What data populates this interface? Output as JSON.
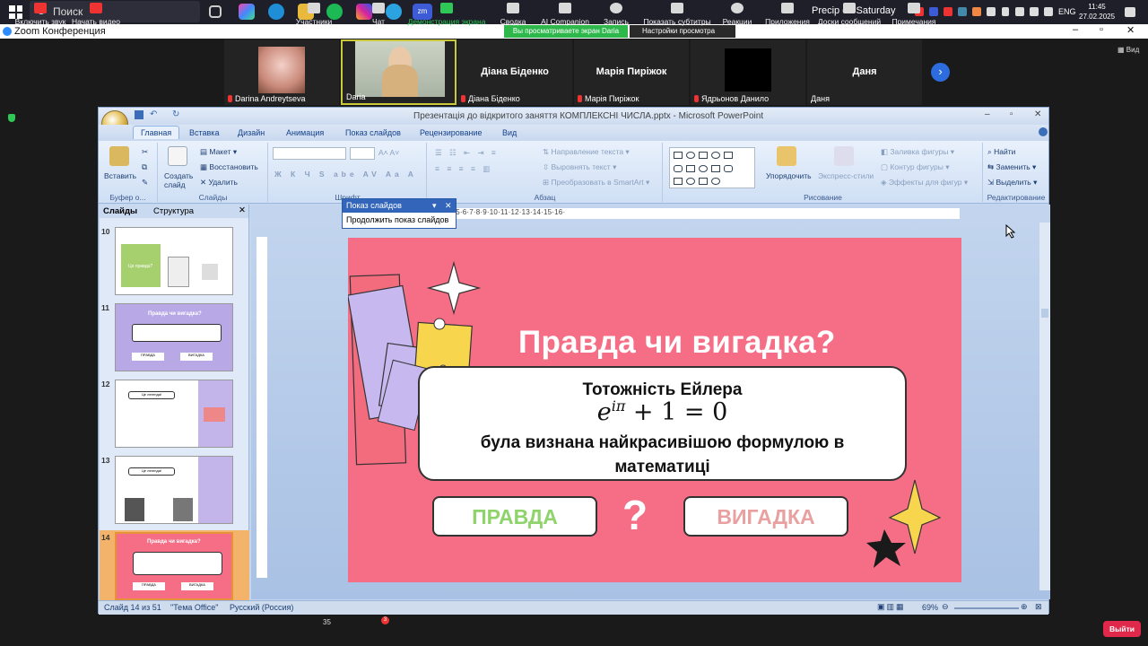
{
  "taskbar": {
    "search_label": "Поиск",
    "weather": "Precip on Saturday",
    "lang": "ENG",
    "time": "11:45",
    "date": "27.02.2025"
  },
  "zoom_window": {
    "title": "Zoom Конференция",
    "share_banner": "Вы просматриваете экран Daria",
    "view_settings": "Настройки просмотра",
    "view_label": "Вид"
  },
  "participants": [
    {
      "name": "Darina Andreytseva"
    },
    {
      "name": "Daria"
    },
    {
      "name": "Діана Біденко",
      "display": "Діана Біденко"
    },
    {
      "name": "Марія Пиріжок",
      "display": "Марія Пиріжок"
    },
    {
      "name": "Ядрьонов Данило"
    },
    {
      "name": "Даня",
      "display": "Даня"
    }
  ],
  "ppt": {
    "title": "Презентація до відкритого заняття КОМПЛЕКСНІ ЧИСЛА.pptx - Microsoft PowerPoint",
    "tabs": [
      "Главная",
      "Вставка",
      "Дизайн",
      "Анимация",
      "Показ слайдов",
      "Рецензирование",
      "Вид"
    ],
    "ribbon": {
      "paste": "Вставить",
      "clipboard": "Буфер о...",
      "create_slide": "Создать слайд",
      "layout": "Макет",
      "restore": "Восстановить",
      "delete": "Удалить",
      "slides_group": "Слайды",
      "font_group": "Шрифт",
      "text_direction": "Направление текста",
      "align_text": "Выровнять текст",
      "smartart": "Преобразовать в SmartArt",
      "paragraph_group": "Абзац",
      "arrange": "Упорядочить",
      "express_styles": "Экспресс-стили",
      "shape_fill": "Заливка фигуры",
      "shape_outline": "Контур фигуры",
      "shape_effects": "Эффекты для фигур",
      "drawing_group": "Рисование",
      "find": "Найти",
      "replace": "Заменить",
      "select": "Выделить",
      "editing_group": "Редактирование"
    },
    "pane_tabs": [
      "Слайды",
      "Структура"
    ],
    "slide_numbers": [
      "10",
      "11",
      "12",
      "13",
      "14"
    ],
    "thumb_texts": {
      "t10_label": "Це правда?",
      "t11_title": "Правда чи вигадка?",
      "t11_true": "ПРАВДА",
      "t11_false": "ВИГАДКА",
      "t12_label": "Це легенда!",
      "t13_label": "Це легенда!",
      "t14_title": "Правда чи вигадка?",
      "t14_true": "ПРАВДА",
      "t14_false": "ВИГАДКА"
    },
    "ruler_h": "·10·9·8·7·6·5·4·3·2·1·0·1·2·3·4·5·6·7·8·9·10·11·12·13·14·15·16·",
    "status": {
      "slide_of": "Слайд 14 из 51",
      "theme": "\"Тема Office\"",
      "language": "Русский (Россия)",
      "zoom": "69%"
    }
  },
  "slide": {
    "heading": "Правда чи вигадка?",
    "line1": "Тотожність Ейлера",
    "formula": "e^{iπ} + 1 = 0",
    "formula_base": "e",
    "formula_exp": "iπ",
    "formula_rest": " + 1 = 0",
    "line3a": "була визнана найкрасивішою формулою в",
    "line3b": "математиці",
    "true_label": "ПРАВДА",
    "false_label": "ВИГАДКА",
    "qmark": "?",
    "colors": {
      "bg": "#f56e86",
      "true": "#8fd36b",
      "false": "#e8a0a0"
    }
  },
  "slideshow_popup": {
    "title": "Показ слайдов",
    "continue": "Продолжить показ слайдов"
  },
  "zoom_toolbar": [
    {
      "label": "Включить звук"
    },
    {
      "label": "Начать видео"
    },
    {
      "label": "Участники",
      "count": "35"
    },
    {
      "label": "Чат",
      "badge": "3"
    },
    {
      "label": "Демонстрация экрана"
    },
    {
      "label": "Сводка"
    },
    {
      "label": "AI Companion"
    },
    {
      "label": "Запись"
    },
    {
      "label": "Показать субтитры"
    },
    {
      "label": "Реакции"
    },
    {
      "label": "Приложения"
    },
    {
      "label": "Доски сообщений"
    },
    {
      "label": "Примечания"
    }
  ],
  "exit_label": "Выйти"
}
